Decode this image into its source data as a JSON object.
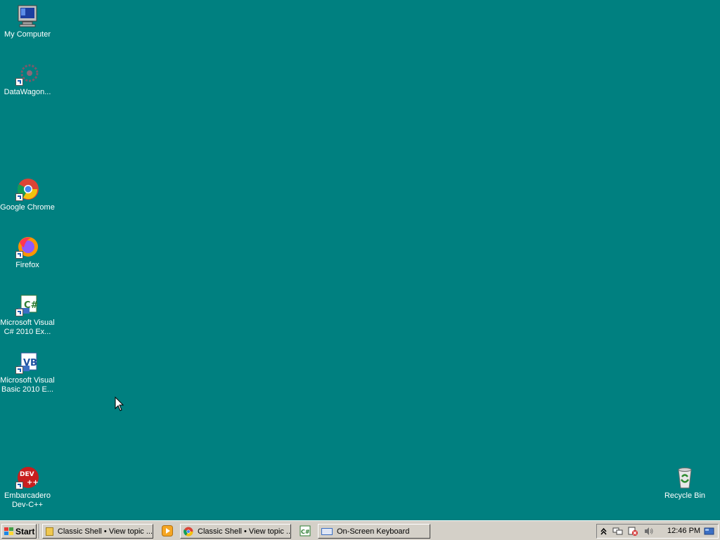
{
  "desktop": {
    "background_color": "#008080",
    "icons": [
      {
        "label": "My Computer",
        "icon": "my-computer-icon"
      },
      {
        "label": "DataWagon...",
        "icon": "datawagon-icon"
      },
      {
        "label": "Google Chrome",
        "icon": "chrome-icon"
      },
      {
        "label": "Firefox",
        "icon": "firefox-icon"
      },
      {
        "label": "Microsoft Visual\nC# 2010 Ex...",
        "icon": "visual-csharp-icon"
      },
      {
        "label": "Microsoft Visual\nBasic 2010 E...",
        "icon": "visual-basic-icon"
      },
      {
        "label": "Embarcadero\nDev-C++",
        "icon": "devcpp-icon"
      },
      {
        "label": "Recycle Bin",
        "icon": "recycle-bin-icon"
      }
    ]
  },
  "taskbar": {
    "start_label": "Start",
    "tasks": [
      {
        "label": "Classic Shell • View topic ...",
        "icon": "folder-icon"
      },
      {
        "label": "Classic Shell • View topic ...",
        "icon": "chrome-icon"
      },
      {
        "label": "On-Screen Keyboard",
        "icon": "keyboard-icon"
      }
    ],
    "quicklaunch": [
      "media-player-icon",
      "visual-csharp-icon"
    ],
    "tray": {
      "icons": [
        "show-hidden-icon",
        "network-icon",
        "security-alert-icon",
        "volume-icon"
      ],
      "clock": "12:46 PM"
    }
  }
}
